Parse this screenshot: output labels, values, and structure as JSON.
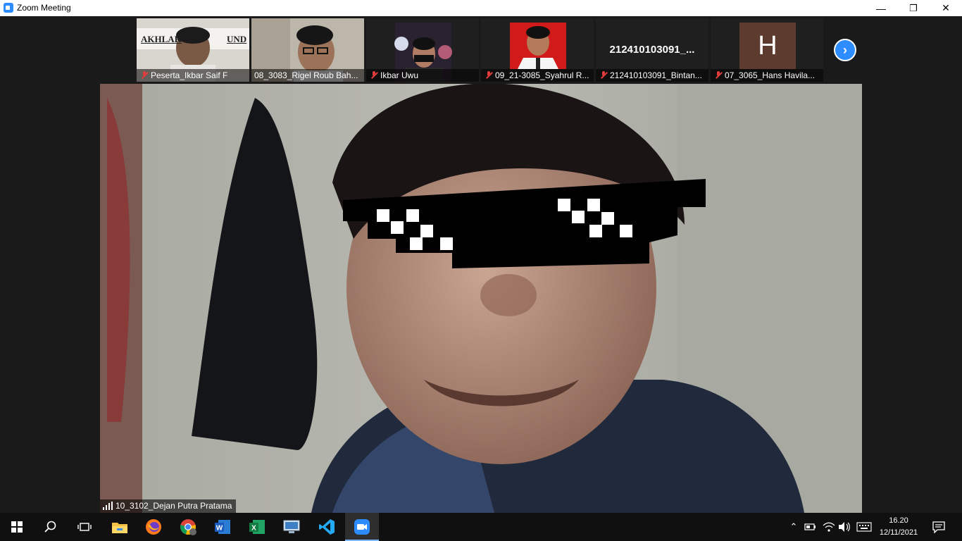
{
  "window": {
    "title": "Zoom Meeting",
    "minimize_glyph": "—",
    "maximize_glyph": "❐",
    "close_glyph": "✕"
  },
  "thumbnails": [
    {
      "name": "Peserta_Ikbar Saif F",
      "muted": true,
      "banner_left": "AKHLAK",
      "banner_right": "UND"
    },
    {
      "name": "08_3083_Rigel Roub Bah...",
      "muted": false
    },
    {
      "name": "Ikbar Uwu",
      "muted": true
    },
    {
      "name": "09_21-3085_Syahrul R...",
      "muted": true
    },
    {
      "name": "212410103091_Bintan...",
      "muted": true,
      "display_text": "212410103091_..."
    },
    {
      "name": "07_3065_Hans Havila...",
      "muted": true,
      "avatar_letter": "H"
    }
  ],
  "next_page_glyph": "›",
  "main_video": {
    "speaker_name": "10_3102_Dejan Putra Pratama"
  },
  "taskbar": {
    "items": [
      "start",
      "search",
      "task-view",
      "file-explorer",
      "firefox",
      "chrome",
      "word",
      "excel",
      "remote-desktop",
      "vscode",
      "zoom"
    ],
    "active": "zoom",
    "tray_up_glyph": "⌃",
    "time": "16.20",
    "date": "12/11/2021"
  },
  "colors": {
    "zoom_blue": "#2d8cff",
    "muted_red": "#e03c3c",
    "taskbar_bg": "#101010",
    "stage_bg": "#1a1a1a"
  }
}
